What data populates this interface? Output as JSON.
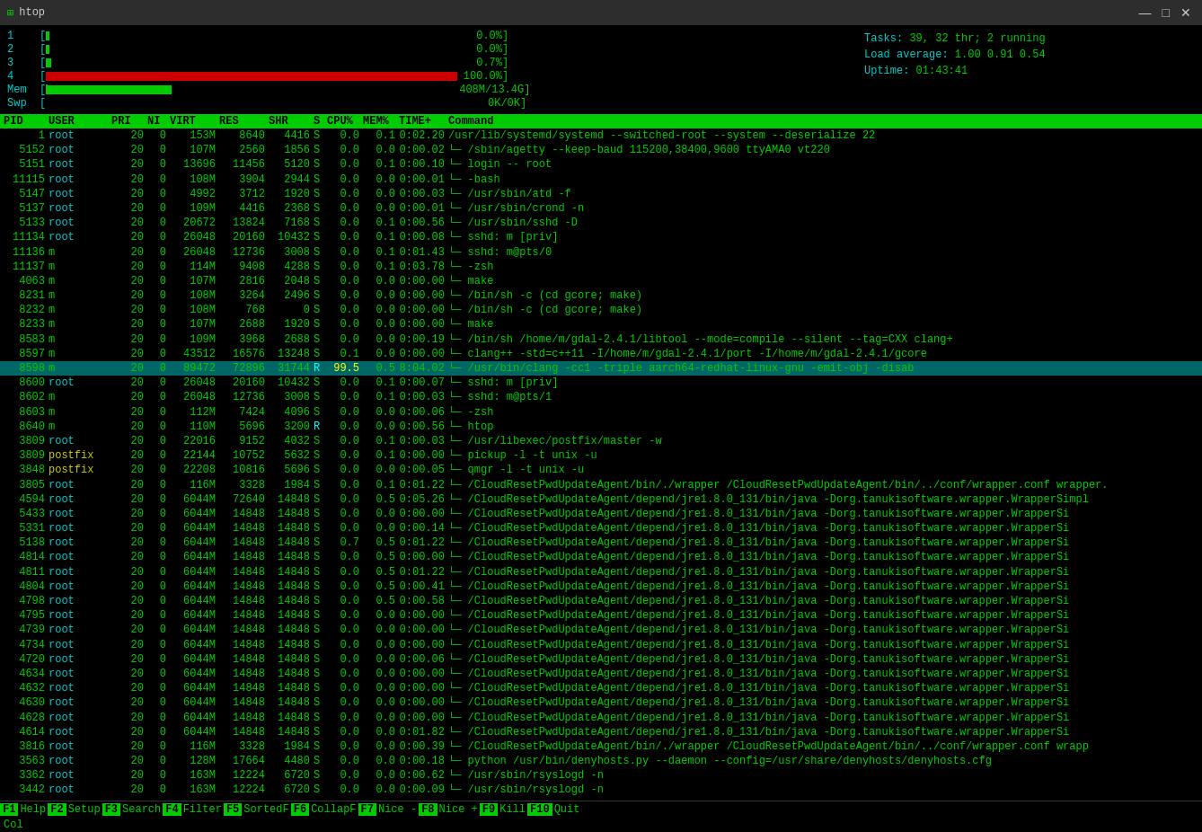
{
  "window": {
    "title": "htop",
    "controls": [
      "—",
      "□",
      "✕"
    ]
  },
  "header": {
    "cpu_bars": [
      {
        "id": "1",
        "fill_pct": 1,
        "value": "0.0%"
      },
      {
        "id": "2",
        "fill_pct": 1,
        "value": "0.0%"
      },
      {
        "id": "3",
        "fill_pct": 1,
        "value": "0.7%"
      },
      {
        "id": "4",
        "fill_pct": 99,
        "value": "100.0%"
      }
    ],
    "mem_label": "Mem",
    "mem_fill": 30,
    "mem_value": "408M/13.4G",
    "swp_label": "Swp",
    "swp_fill": 0,
    "swp_value": "0K/0K",
    "tasks_label": "Tasks:",
    "tasks_count": "39,",
    "tasks_threads": "32",
    "tasks_thr_label": "thr;",
    "tasks_running": "2 running",
    "load_label": "Load average:",
    "load_values": "1.00 0.91 0.54",
    "uptime_label": "Uptime:",
    "uptime_value": "01:43:41"
  },
  "columns": {
    "pid": "PID",
    "user": "USER",
    "pri": "PRI",
    "ni": "NI",
    "virt": "VIRT",
    "res": "RES",
    "shr": "SHR",
    "s": "S",
    "cpu": "CPU%",
    "mem": "MEM%",
    "time": "TIME+",
    "cmd": "Command"
  },
  "processes": [
    {
      "pid": "1",
      "user": "root",
      "pri": "20",
      "ni": "0",
      "virt": "153M",
      "res": "8640",
      "shr": "4416",
      "s": "S",
      "cpu": "0.0",
      "mem": "0.1",
      "time": "0:02.20",
      "cmd": "/usr/lib/systemd/systemd --switched-root --system --deserialize 22"
    },
    {
      "pid": "5152",
      "user": "root",
      "pri": "20",
      "ni": "0",
      "virt": "107M",
      "res": "2560",
      "shr": "1856",
      "s": "S",
      "cpu": "0.0",
      "mem": "0.0",
      "time": "0:00.02",
      "cmd": "└─ /sbin/agetty --keep-baud 115200,38400,9600 ttyAMA0 vt220"
    },
    {
      "pid": "5151",
      "user": "root",
      "pri": "20",
      "ni": "0",
      "virt": "13696",
      "res": "11456",
      "shr": "5120",
      "s": "S",
      "cpu": "0.0",
      "mem": "0.1",
      "time": "0:00.10",
      "cmd": "└─ login -- root"
    },
    {
      "pid": "11115",
      "user": "root",
      "pri": "20",
      "ni": "0",
      "virt": "108M",
      "res": "3904",
      "shr": "2944",
      "s": "S",
      "cpu": "0.0",
      "mem": "0.0",
      "time": "0:00.01",
      "cmd": "  └─ -bash"
    },
    {
      "pid": "5147",
      "user": "root",
      "pri": "20",
      "ni": "0",
      "virt": "4992",
      "res": "3712",
      "shr": "1920",
      "s": "S",
      "cpu": "0.0",
      "mem": "0.0",
      "time": "0:00.03",
      "cmd": "└─ /usr/sbin/atd -f"
    },
    {
      "pid": "5137",
      "user": "root",
      "pri": "20",
      "ni": "0",
      "virt": "109M",
      "res": "4416",
      "shr": "2368",
      "s": "S",
      "cpu": "0.0",
      "mem": "0.0",
      "time": "0:00.01",
      "cmd": "└─ /usr/sbin/crond -n"
    },
    {
      "pid": "5133",
      "user": "root",
      "pri": "20",
      "ni": "0",
      "virt": "20672",
      "res": "13824",
      "shr": "7168",
      "s": "S",
      "cpu": "0.0",
      "mem": "0.1",
      "time": "0:00.56",
      "cmd": "└─ /usr/sbin/sshd -D"
    },
    {
      "pid": "11134",
      "user": "root",
      "pri": "20",
      "ni": "0",
      "virt": "26048",
      "res": "20160",
      "shr": "10432",
      "s": "S",
      "cpu": "0.0",
      "mem": "0.1",
      "time": "0:00.08",
      "cmd": "  └─ sshd: m [priv]"
    },
    {
      "pid": "11136",
      "user": "m",
      "pri": "20",
      "ni": "0",
      "virt": "26048",
      "res": "12736",
      "shr": "3008",
      "s": "S",
      "cpu": "0.0",
      "mem": "0.1",
      "time": "0:01.43",
      "cmd": "    └─ sshd: m@pts/0"
    },
    {
      "pid": "11137",
      "user": "m",
      "pri": "20",
      "ni": "0",
      "virt": "114M",
      "res": "9408",
      "shr": "4288",
      "s": "S",
      "cpu": "0.0",
      "mem": "0.1",
      "time": "0:03.78",
      "cmd": "      └─ -zsh"
    },
    {
      "pid": "4063",
      "user": "m",
      "pri": "20",
      "ni": "0",
      "virt": "107M",
      "res": "2816",
      "shr": "2048",
      "s": "S",
      "cpu": "0.0",
      "mem": "0.0",
      "time": "0:00.00",
      "cmd": "        └─ make"
    },
    {
      "pid": "8231",
      "user": "m",
      "pri": "20",
      "ni": "0",
      "virt": "108M",
      "res": "3264",
      "shr": "2496",
      "s": "S",
      "cpu": "0.0",
      "mem": "0.0",
      "time": "0:00.00",
      "cmd": "          └─ /bin/sh -c (cd gcore; make)"
    },
    {
      "pid": "8232",
      "user": "m",
      "pri": "20",
      "ni": "0",
      "virt": "108M",
      "res": "768",
      "shr": "0",
      "s": "S",
      "cpu": "0.0",
      "mem": "0.0",
      "time": "0:00.00",
      "cmd": "            └─ /bin/sh -c (cd gcore; make)"
    },
    {
      "pid": "8233",
      "user": "m",
      "pri": "20",
      "ni": "0",
      "virt": "107M",
      "res": "2688",
      "shr": "1920",
      "s": "S",
      "cpu": "0.0",
      "mem": "0.0",
      "time": "0:00.00",
      "cmd": "              └─ make"
    },
    {
      "pid": "8583",
      "user": "m",
      "pri": "20",
      "ni": "0",
      "virt": "109M",
      "res": "3968",
      "shr": "2688",
      "s": "S",
      "cpu": "0.0",
      "mem": "0.0",
      "time": "0:00.19",
      "cmd": "                └─ /bin/sh /home/m/gdal-2.4.1/libtool --mode=compile --silent --tag=CXX clang+"
    },
    {
      "pid": "8597",
      "user": "m",
      "pri": "20",
      "ni": "0",
      "virt": "43512",
      "res": "16576",
      "shr": "13248",
      "s": "S",
      "cpu": "0.1",
      "mem": "0.0",
      "time": "0:00.00",
      "cmd": "                  └─ clang++ -std=c++11 -I/home/m/gdal-2.4.1/port -I/home/m/gdal-2.4.1/gcore"
    },
    {
      "pid": "8598",
      "user": "m",
      "pri": "20",
      "ni": "0",
      "virt": "89472",
      "res": "72896",
      "shr": "31744",
      "s": "R",
      "cpu": "99.5",
      "mem": "0.5",
      "time": "8:04.02",
      "cmd": "                    └─ /usr/bin/clang -cc1 -triple aarch64-redhat-linux-gnu -emit-obj -disab"
    },
    {
      "pid": "8600",
      "user": "root",
      "pri": "20",
      "ni": "0",
      "virt": "26048",
      "res": "20160",
      "shr": "10432",
      "s": "S",
      "cpu": "0.0",
      "mem": "0.1",
      "time": "0:00.07",
      "cmd": "└─ sshd: m [priv]"
    },
    {
      "pid": "8602",
      "user": "m",
      "pri": "20",
      "ni": "0",
      "virt": "26048",
      "res": "12736",
      "shr": "3008",
      "s": "S",
      "cpu": "0.0",
      "mem": "0.1",
      "time": "0:00.03",
      "cmd": "  └─ sshd: m@pts/1"
    },
    {
      "pid": "8603",
      "user": "m",
      "pri": "20",
      "ni": "0",
      "virt": "112M",
      "res": "7424",
      "shr": "4096",
      "s": "S",
      "cpu": "0.0",
      "mem": "0.0",
      "time": "0:00.06",
      "cmd": "    └─ -zsh"
    },
    {
      "pid": "8640",
      "user": "m",
      "pri": "20",
      "ni": "0",
      "virt": "110M",
      "res": "5696",
      "shr": "3200",
      "s": "R",
      "cpu": "0.0",
      "mem": "0.0",
      "time": "0:00.56",
      "cmd": "      └─ htop"
    },
    {
      "pid": "3809",
      "user": "root",
      "pri": "20",
      "ni": "0",
      "virt": "22016",
      "res": "9152",
      "shr": "4032",
      "s": "S",
      "cpu": "0.0",
      "mem": "0.1",
      "time": "0:00.03",
      "cmd": "└─ /usr/libexec/postfix/master -w"
    },
    {
      "pid": "3809",
      "user": "postfix",
      "pri": "20",
      "ni": "0",
      "virt": "22144",
      "res": "10752",
      "shr": "5632",
      "s": "S",
      "cpu": "0.0",
      "mem": "0.1",
      "time": "0:00.00",
      "cmd": "  └─ pickup -l -t unix -u"
    },
    {
      "pid": "3848",
      "user": "postfix",
      "pri": "20",
      "ni": "0",
      "virt": "22208",
      "res": "10816",
      "shr": "5696",
      "s": "S",
      "cpu": "0.0",
      "mem": "0.0",
      "time": "0:00.05",
      "cmd": "  └─ qmgr -l -t unix -u"
    },
    {
      "pid": "3805",
      "user": "root",
      "pri": "20",
      "ni": "0",
      "virt": "116M",
      "res": "3328",
      "shr": "1984",
      "s": "S",
      "cpu": "0.0",
      "mem": "0.1",
      "time": "0:01.22",
      "cmd": "└─ /CloudResetPwdUpdateAgent/bin/./wrapper /CloudResetPwdUpdateAgent/bin/../conf/wrapper.conf wrapper."
    },
    {
      "pid": "4594",
      "user": "root",
      "pri": "20",
      "ni": "0",
      "virt": "6044M",
      "res": "72640",
      "shr": "14848",
      "s": "S",
      "cpu": "0.0",
      "mem": "0.5",
      "time": "0:05.26",
      "cmd": "  └─ /CloudResetPwdUpdateAgent/depend/jre1.8.0_131/bin/java -Dorg.tanukisoftware.wrapper.WrapperSimpl"
    },
    {
      "pid": "5433",
      "user": "root",
      "pri": "20",
      "ni": "0",
      "virt": "6044M",
      "res": "14848",
      "shr": "14848",
      "s": "S",
      "cpu": "0.0",
      "mem": "0.0",
      "time": "0:00.00",
      "cmd": "    └─ /CloudResetPwdUpdateAgent/depend/jre1.8.0_131/bin/java -Dorg.tanukisoftware.wrapper.WrapperSi"
    },
    {
      "pid": "5331",
      "user": "root",
      "pri": "20",
      "ni": "0",
      "virt": "6044M",
      "res": "14848",
      "shr": "14848",
      "s": "S",
      "cpu": "0.0",
      "mem": "0.0",
      "time": "0:00.14",
      "cmd": "    └─ /CloudResetPwdUpdateAgent/depend/jre1.8.0_131/bin/java -Dorg.tanukisoftware.wrapper.WrapperSi"
    },
    {
      "pid": "5138",
      "user": "root",
      "pri": "20",
      "ni": "0",
      "virt": "6044M",
      "res": "14848",
      "shr": "14848",
      "s": "S",
      "cpu": "0.7",
      "mem": "0.5",
      "time": "0:01.22",
      "cmd": "    └─ /CloudResetPwdUpdateAgent/depend/jre1.8.0_131/bin/java -Dorg.tanukisoftware.wrapper.WrapperSi"
    },
    {
      "pid": "4814",
      "user": "root",
      "pri": "20",
      "ni": "0",
      "virt": "6044M",
      "res": "14848",
      "shr": "14848",
      "s": "S",
      "cpu": "0.0",
      "mem": "0.5",
      "time": "0:00.00",
      "cmd": "    └─ /CloudResetPwdUpdateAgent/depend/jre1.8.0_131/bin/java -Dorg.tanukisoftware.wrapper.WrapperSi"
    },
    {
      "pid": "4811",
      "user": "root",
      "pri": "20",
      "ni": "0",
      "virt": "6044M",
      "res": "14848",
      "shr": "14848",
      "s": "S",
      "cpu": "0.0",
      "mem": "0.5",
      "time": "0:01.22",
      "cmd": "    └─ /CloudResetPwdUpdateAgent/depend/jre1.8.0_131/bin/java -Dorg.tanukisoftware.wrapper.WrapperSi"
    },
    {
      "pid": "4804",
      "user": "root",
      "pri": "20",
      "ni": "0",
      "virt": "6044M",
      "res": "14848",
      "shr": "14848",
      "s": "S",
      "cpu": "0.0",
      "mem": "0.5",
      "time": "0:00.41",
      "cmd": "    └─ /CloudResetPwdUpdateAgent/depend/jre1.8.0_131/bin/java -Dorg.tanukisoftware.wrapper.WrapperSi"
    },
    {
      "pid": "4798",
      "user": "root",
      "pri": "20",
      "ni": "0",
      "virt": "6044M",
      "res": "14848",
      "shr": "14848",
      "s": "S",
      "cpu": "0.0",
      "mem": "0.5",
      "time": "0:00.58",
      "cmd": "    └─ /CloudResetPwdUpdateAgent/depend/jre1.8.0_131/bin/java -Dorg.tanukisoftware.wrapper.WrapperSi"
    },
    {
      "pid": "4795",
      "user": "root",
      "pri": "20",
      "ni": "0",
      "virt": "6044M",
      "res": "14848",
      "shr": "14848",
      "s": "S",
      "cpu": "0.0",
      "mem": "0.0",
      "time": "0:00.00",
      "cmd": "    └─ /CloudResetPwdUpdateAgent/depend/jre1.8.0_131/bin/java -Dorg.tanukisoftware.wrapper.WrapperSi"
    },
    {
      "pid": "4739",
      "user": "root",
      "pri": "20",
      "ni": "0",
      "virt": "6044M",
      "res": "14848",
      "shr": "14848",
      "s": "S",
      "cpu": "0.0",
      "mem": "0.0",
      "time": "0:00.00",
      "cmd": "    └─ /CloudResetPwdUpdateAgent/depend/jre1.8.0_131/bin/java -Dorg.tanukisoftware.wrapper.WrapperSi"
    },
    {
      "pid": "4734",
      "user": "root",
      "pri": "20",
      "ni": "0",
      "virt": "6044M",
      "res": "14848",
      "shr": "14848",
      "s": "S",
      "cpu": "0.0",
      "mem": "0.0",
      "time": "0:00.00",
      "cmd": "    └─ /CloudResetPwdUpdateAgent/depend/jre1.8.0_131/bin/java -Dorg.tanukisoftware.wrapper.WrapperSi"
    },
    {
      "pid": "4720",
      "user": "root",
      "pri": "20",
      "ni": "0",
      "virt": "6044M",
      "res": "14848",
      "shr": "14848",
      "s": "S",
      "cpu": "0.0",
      "mem": "0.0",
      "time": "0:00.06",
      "cmd": "    └─ /CloudResetPwdUpdateAgent/depend/jre1.8.0_131/bin/java -Dorg.tanukisoftware.wrapper.WrapperSi"
    },
    {
      "pid": "4634",
      "user": "root",
      "pri": "20",
      "ni": "0",
      "virt": "6044M",
      "res": "14848",
      "shr": "14848",
      "s": "S",
      "cpu": "0.0",
      "mem": "0.0",
      "time": "0:00.00",
      "cmd": "    └─ /CloudResetPwdUpdateAgent/depend/jre1.8.0_131/bin/java -Dorg.tanukisoftware.wrapper.WrapperSi"
    },
    {
      "pid": "4632",
      "user": "root",
      "pri": "20",
      "ni": "0",
      "virt": "6044M",
      "res": "14848",
      "shr": "14848",
      "s": "S",
      "cpu": "0.0",
      "mem": "0.0",
      "time": "0:00.00",
      "cmd": "    └─ /CloudResetPwdUpdateAgent/depend/jre1.8.0_131/bin/java -Dorg.tanukisoftware.wrapper.WrapperSi"
    },
    {
      "pid": "4630",
      "user": "root",
      "pri": "20",
      "ni": "0",
      "virt": "6044M",
      "res": "14848",
      "shr": "14848",
      "s": "S",
      "cpu": "0.0",
      "mem": "0.0",
      "time": "0:00.00",
      "cmd": "    └─ /CloudResetPwdUpdateAgent/depend/jre1.8.0_131/bin/java -Dorg.tanukisoftware.wrapper.WrapperSi"
    },
    {
      "pid": "4628",
      "user": "root",
      "pri": "20",
      "ni": "0",
      "virt": "6044M",
      "res": "14848",
      "shr": "14848",
      "s": "S",
      "cpu": "0.0",
      "mem": "0.0",
      "time": "0:00.00",
      "cmd": "    └─ /CloudResetPwdUpdateAgent/depend/jre1.8.0_131/bin/java -Dorg.tanukisoftware.wrapper.WrapperSi"
    },
    {
      "pid": "4614",
      "user": "root",
      "pri": "20",
      "ni": "0",
      "virt": "6044M",
      "res": "14848",
      "shr": "14848",
      "s": "S",
      "cpu": "0.0",
      "mem": "0.0",
      "time": "0:01.82",
      "cmd": "    └─ /CloudResetPwdUpdateAgent/depend/jre1.8.0_131/bin/java -Dorg.tanukisoftware.wrapper.WrapperSi"
    },
    {
      "pid": "3816",
      "user": "root",
      "pri": "20",
      "ni": "0",
      "virt": "116M",
      "res": "3328",
      "shr": "1984",
      "s": "S",
      "cpu": "0.0",
      "mem": "0.0",
      "time": "0:00.39",
      "cmd": "└─ /CloudResetPwdUpdateAgent/bin/./wrapper /CloudResetPwdUpdateAgent/bin/../conf/wrapper.conf wrapp"
    },
    {
      "pid": "3563",
      "user": "root",
      "pri": "20",
      "ni": "0",
      "virt": "128M",
      "res": "17664",
      "shr": "4480",
      "s": "S",
      "cpu": "0.0",
      "mem": "0.0",
      "time": "0:00.18",
      "cmd": "└─ python /usr/bin/denyhosts.py --daemon --config=/usr/share/denyhosts/denyhosts.cfg"
    },
    {
      "pid": "3362",
      "user": "root",
      "pri": "20",
      "ni": "0",
      "virt": "163M",
      "res": "12224",
      "shr": "6720",
      "s": "S",
      "cpu": "0.0",
      "mem": "0.0",
      "time": "0:00.62",
      "cmd": "└─ /usr/sbin/rsyslogd -n"
    },
    {
      "pid": "3442",
      "user": "root",
      "pri": "20",
      "ni": "0",
      "virt": "163M",
      "res": "12224",
      "shr": "6720",
      "s": "S",
      "cpu": "0.0",
      "mem": "0.0",
      "time": "0:00.09",
      "cmd": "└─ /usr/sbin/rsyslogd -n"
    }
  ],
  "footer": {
    "items": [
      {
        "key": "F1",
        "label": "Help"
      },
      {
        "key": "F2",
        "label": "Setup"
      },
      {
        "key": "F3",
        "label": "Search"
      },
      {
        "key": "F4",
        "label": "Filter"
      },
      {
        "key": "F5",
        "label": "SortedF"
      },
      {
        "key": "F6",
        "label": "CollapF"
      },
      {
        "key": "F7",
        "label": "Nice -"
      },
      {
        "key": "F8",
        "label": "Nice +"
      },
      {
        "key": "F9",
        "label": "Kill"
      },
      {
        "key": "F10",
        "label": "Quit"
      }
    ]
  },
  "statusbar": {
    "col_label": "Col"
  }
}
